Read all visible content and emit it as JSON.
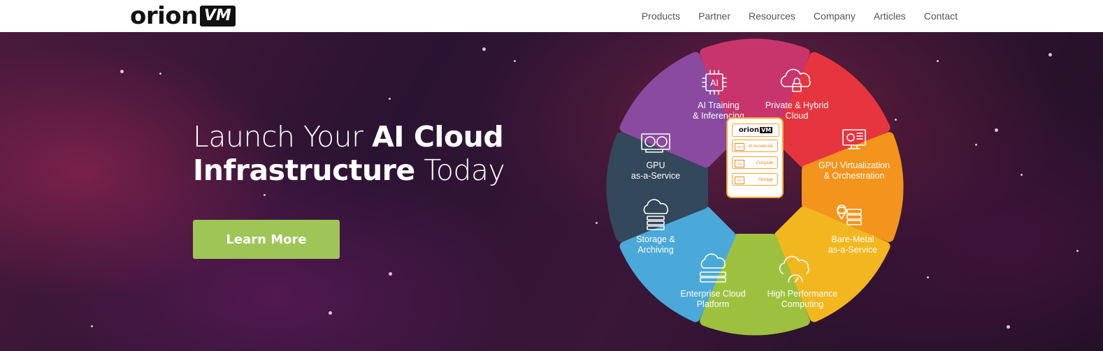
{
  "header": {
    "logo_text": "orion",
    "logo_box": "VM",
    "nav": [
      "Products",
      "Partner",
      "Resources",
      "Company",
      "Articles",
      "Contact"
    ]
  },
  "hero": {
    "headline_line1_light": "Launch Your ",
    "headline_line1_bold": "AI Cloud",
    "headline_line2_bold": "Infrastructure",
    "headline_line2_light": " Today",
    "cta_label": "Learn More"
  },
  "diagram": {
    "center": {
      "logo_text": "orion",
      "logo_box": "VM",
      "rows": [
        {
          "tag": "GPU",
          "label": "AI Accelerate"
        },
        {
          "tag": "CPU",
          "label": "Compute"
        },
        {
          "tag": "SSD",
          "label": "Storage"
        }
      ]
    },
    "petals": [
      {
        "label": "AI Training\n& Inferencing",
        "color": "#c8356c",
        "icon": "ai-chip-icon"
      },
      {
        "label": "Private & Hybrid\nCloud",
        "color": "#e6353f",
        "icon": "cloud-lock-icon"
      },
      {
        "label": "GPU Virtualization\n& Orchestration",
        "color": "#f3941c",
        "icon": "monitor-gear-icon"
      },
      {
        "label": "Bare-Metal\nas-a-Service",
        "color": "#f2b71f",
        "icon": "server-pin-icon"
      },
      {
        "label": "High Performance\nComputing",
        "color": "#9dc13f",
        "icon": "cloud-gauge-icon"
      },
      {
        "label": "Enterprise Cloud\nPlatform",
        "color": "#4aa9d9",
        "icon": "cloud-servers-icon"
      },
      {
        "label": "Storage &\nArchiving",
        "color": "#33485a",
        "icon": "cloud-storage-icon"
      },
      {
        "label": "GPU\nas-a-Service",
        "color": "#8a4aa0",
        "icon": "gpu-card-icon"
      }
    ]
  }
}
